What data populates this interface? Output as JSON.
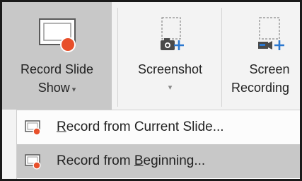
{
  "ribbon": {
    "record_slide_show": {
      "line1": "Record Slide",
      "line2": "Show",
      "caret": "▾",
      "icon": "record-slide-show-icon"
    },
    "screenshot": {
      "label": "Screenshot",
      "caret": "▾",
      "icon": "screenshot-icon"
    },
    "screen_recording": {
      "line1": "Screen",
      "line2": "Recording",
      "icon": "screen-recording-icon"
    }
  },
  "menu": {
    "items": [
      {
        "prefix": "",
        "mnemonic": "R",
        "suffix": "ecord from Current Slide...",
        "icon": "record-slide-icon"
      },
      {
        "prefix": "Record from ",
        "mnemonic": "B",
        "suffix": "eginning...",
        "icon": "record-slide-icon"
      }
    ]
  },
  "colors": {
    "record_dot": "#e8502b",
    "accent_blue": "#2b78d0",
    "selected_bg": "#c8c8c8"
  }
}
